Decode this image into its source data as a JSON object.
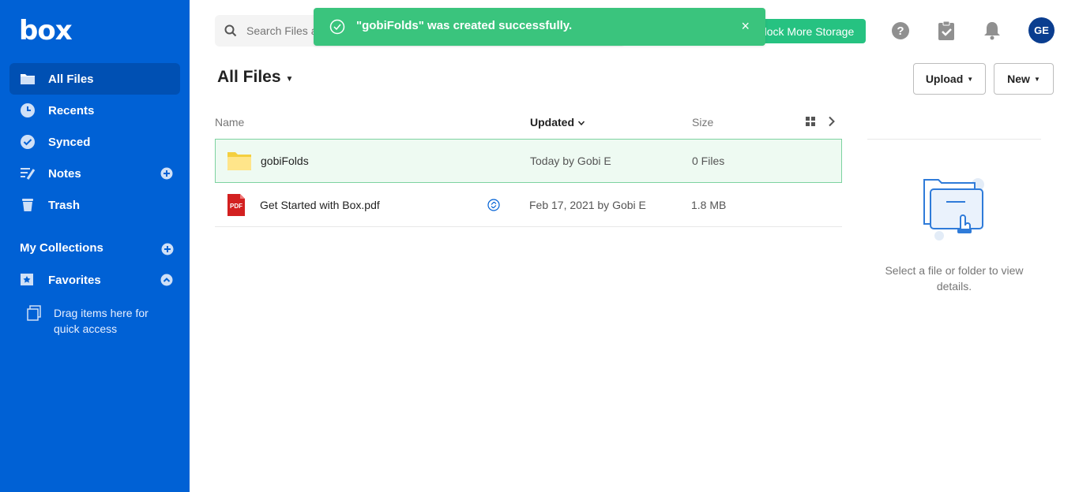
{
  "app": {
    "logo": "box"
  },
  "sidebar": {
    "items": [
      {
        "label": "All Files",
        "icon": "folder-icon",
        "active": true
      },
      {
        "label": "Recents",
        "icon": "clock-icon"
      },
      {
        "label": "Synced",
        "icon": "check-circle-icon"
      },
      {
        "label": "Notes",
        "icon": "notes-icon"
      },
      {
        "label": "Trash",
        "icon": "trash-icon"
      }
    ],
    "collections_label": "My Collections",
    "favorites_label": "Favorites",
    "drag_hint": "Drag items here for quick access"
  },
  "header": {
    "search_placeholder": "Search Files and Folders",
    "upgrade_label": "Unlock More Storage",
    "avatar_initials": "GE"
  },
  "toast": {
    "message": "\"gobiFolds\" was created successfully.",
    "close": "×"
  },
  "main": {
    "title": "All Files",
    "upload_label": "Upload",
    "new_label": "New",
    "columns": {
      "name": "Name",
      "updated": "Updated",
      "size": "Size"
    },
    "rows": [
      {
        "name": "gobiFolds",
        "updated": "Today by Gobi E",
        "size": "0 Files",
        "type": "folder",
        "selected": true
      },
      {
        "name": "Get Started with Box.pdf",
        "updated": "Feb 17, 2021 by Gobi E",
        "size": "1.8 MB",
        "type": "pdf",
        "pdf_badge": "PDF",
        "shared": true
      }
    ]
  },
  "details_panel": {
    "empty_text": "Select a file or folder to view details."
  },
  "colors": {
    "sidebar": "#0061d5",
    "accent": "#26c281",
    "toast": "#3ac47d"
  }
}
